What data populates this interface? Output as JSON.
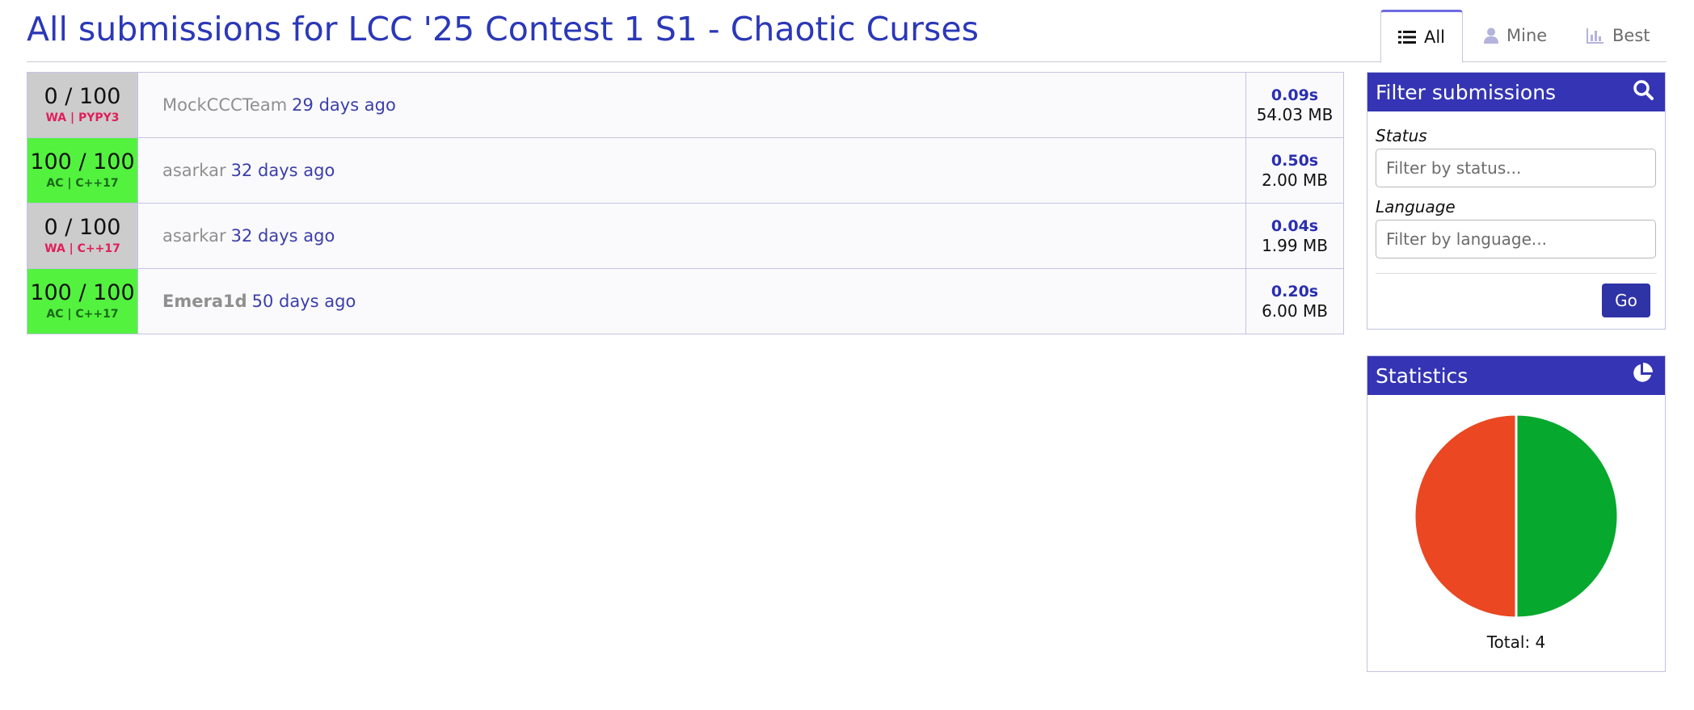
{
  "page": {
    "title": "All submissions for LCC '25 Contest 1 S1 - Chaotic Curses"
  },
  "tabs": [
    {
      "label": "All",
      "icon": "list-icon",
      "active": true
    },
    {
      "label": "Mine",
      "icon": "user-icon",
      "active": false
    },
    {
      "label": "Best",
      "icon": "bar-chart-icon",
      "active": false
    }
  ],
  "submissions": [
    {
      "score": "0 / 100",
      "meta": "WA | PYPY3",
      "status": "wa",
      "user": "MockCCCTeam",
      "user_bold": false,
      "ago": "29 days ago",
      "time": "0.09s",
      "memory": "54.03 MB"
    },
    {
      "score": "100 / 100",
      "meta": "AC | C++17",
      "status": "ac",
      "user": "asarkar",
      "user_bold": false,
      "ago": "32 days ago",
      "time": "0.50s",
      "memory": "2.00 MB"
    },
    {
      "score": "0 / 100",
      "meta": "WA | C++17",
      "status": "wa",
      "user": "asarkar",
      "user_bold": false,
      "ago": "32 days ago",
      "time": "0.04s",
      "memory": "1.99 MB"
    },
    {
      "score": "100 / 100",
      "meta": "AC | C++17",
      "status": "ac",
      "user": "Emera1d",
      "user_bold": true,
      "ago": "50 days ago",
      "time": "0.20s",
      "memory": "6.00 MB"
    }
  ],
  "filter": {
    "title": "Filter submissions",
    "status_label": "Status",
    "status_placeholder": "Filter by status...",
    "language_label": "Language",
    "language_placeholder": "Filter by language...",
    "go_label": "Go"
  },
  "statistics": {
    "title": "Statistics",
    "total_label": "Total: 4",
    "slices": [
      {
        "status": "AC",
        "count": 2,
        "color": "#07a82e"
      },
      {
        "status": "WA",
        "count": 2,
        "color": "#ea4722"
      }
    ]
  },
  "colors": {
    "accent": "#3434b4",
    "title": "#2b38b8",
    "ac": "#53f23f",
    "wa": "#cccccc"
  }
}
